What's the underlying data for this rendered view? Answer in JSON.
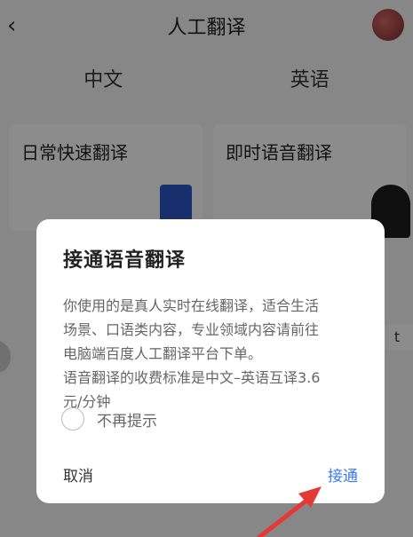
{
  "app": {
    "back_glyph": "‹",
    "title": "人工翻译",
    "source_lang": "中文",
    "target_lang": "英语",
    "cards": [
      {
        "title": "日常快速翻译",
        "lines": [
          "",
          ""
        ]
      },
      {
        "title": "即时语音翻译",
        "lines": [
          "",
          ""
        ]
      }
    ],
    "side_glyph": "t"
  },
  "dialog": {
    "title": "接通语音翻译",
    "body_lines": [
      "你使用的是真人实时在线翻译，适合生活",
      "场景、口语类内容，专业领域内容请前往",
      "电脑端百度人工翻译平台下单。",
      "语音翻译的收费标准是中文–英语互译3.6",
      "元/分钟"
    ],
    "dont_remind_label": "不再提示",
    "dont_remind_checked": false,
    "cancel_label": "取消",
    "confirm_label": "接通"
  },
  "colors": {
    "accent": "#3a7af0",
    "annotation_arrow": "#e53935"
  }
}
